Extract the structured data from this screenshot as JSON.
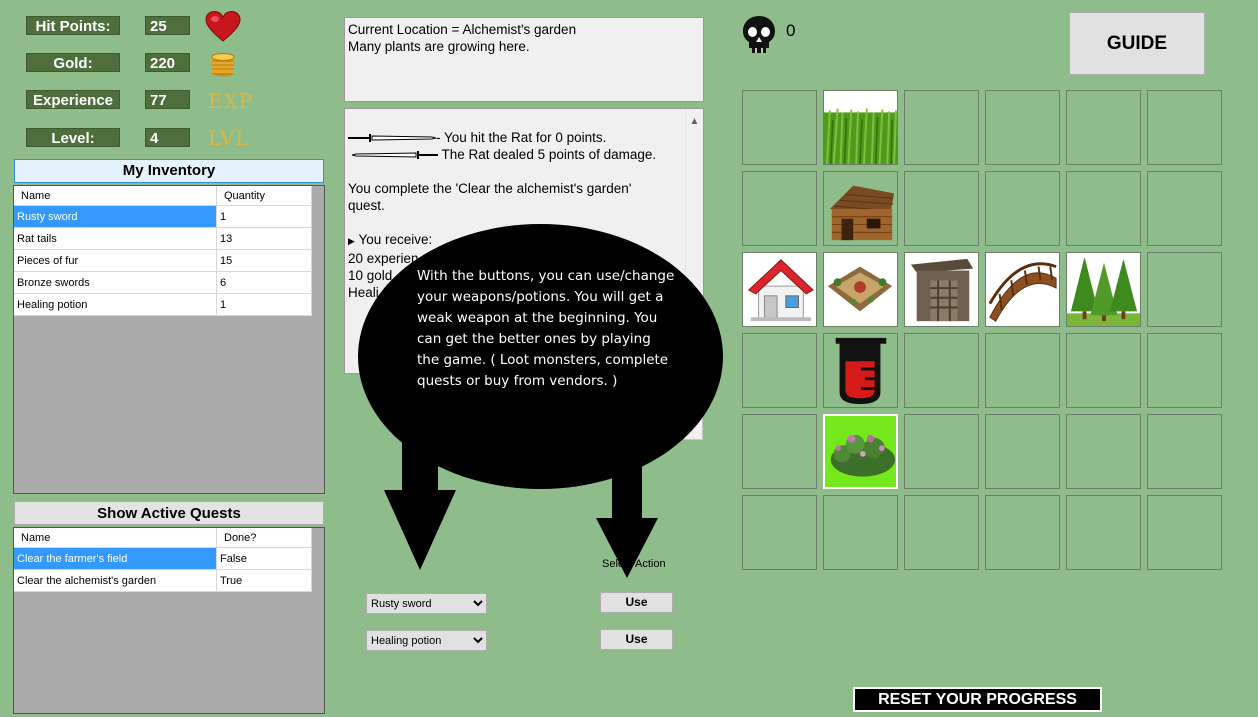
{
  "stats": {
    "hit_points": {
      "label": "Hit Points:",
      "value": "25",
      "icon": "heart-icon"
    },
    "gold": {
      "label": "Gold:",
      "value": "220",
      "icon": "gold-coins-icon"
    },
    "experience": {
      "label": "Experience",
      "value": "77",
      "icon_text": "EXP"
    },
    "level": {
      "label": "Level:",
      "value": "4",
      "icon_text": "LVL"
    }
  },
  "inventory": {
    "title": "My Inventory",
    "columns": [
      "Name",
      "Quantity"
    ],
    "rows": [
      {
        "name": "Rusty sword",
        "qty": "1"
      },
      {
        "name": "Rat tails",
        "qty": "13"
      },
      {
        "name": "Pieces of fur",
        "qty": "15"
      },
      {
        "name": "Bronze swords",
        "qty": "6"
      },
      {
        "name": "Healing potion",
        "qty": "1"
      }
    ]
  },
  "quests": {
    "title": "Show Active Quests",
    "columns": [
      "Name",
      "Done?"
    ],
    "rows": [
      {
        "name": "Clear the farmer's field",
        "done": "False"
      },
      {
        "name": "Clear the alchemist's garden",
        "done": "True"
      }
    ]
  },
  "location": {
    "line1": "Current Location = Alchemist's garden",
    "line2": "Many plants are growing here."
  },
  "log": {
    "hit": "- You hit the Rat for 0 points.",
    "dealt": "The Rat dealed 5 points of damage.",
    "complete1": "You complete the 'Clear the alchemist's garden'",
    "complete2": "quest.",
    "receive": "You receive:",
    "xp_partial": "20 experien",
    "gold_partial": "10 gold",
    "heal_partial": "Heali"
  },
  "tooltip": {
    "text": "With the buttons, you can use/change your weapons/potions. You will get a weak weapon at the beginning. You can get the better ones by playing the game. ( Loot monsters, complete quests or buy from vendors. )"
  },
  "actions": {
    "select_label": "Select Action",
    "weapon_selected": "Rusty sword",
    "potion_selected": "Healing potion",
    "use_label": "Use"
  },
  "kills": {
    "count": "0",
    "icon": "skull-icon"
  },
  "guide_label": "GUIDE",
  "reset_label": "RESET YOUR PROGRESS",
  "map_tiles": [
    {
      "name": "grass-field",
      "icon": "grass"
    },
    {
      "name": "farm-house",
      "icon": "wooden-hut"
    },
    {
      "name": "home",
      "icon": "house"
    },
    {
      "name": "town-square",
      "icon": "town-square"
    },
    {
      "name": "guard-post",
      "icon": "gate"
    },
    {
      "name": "bridge",
      "icon": "bridge"
    },
    {
      "name": "forest",
      "icon": "trees"
    },
    {
      "name": "alchemist-hut",
      "icon": "potion-beaker"
    },
    {
      "name": "alchemist-garden",
      "icon": "garden-plants"
    }
  ]
}
